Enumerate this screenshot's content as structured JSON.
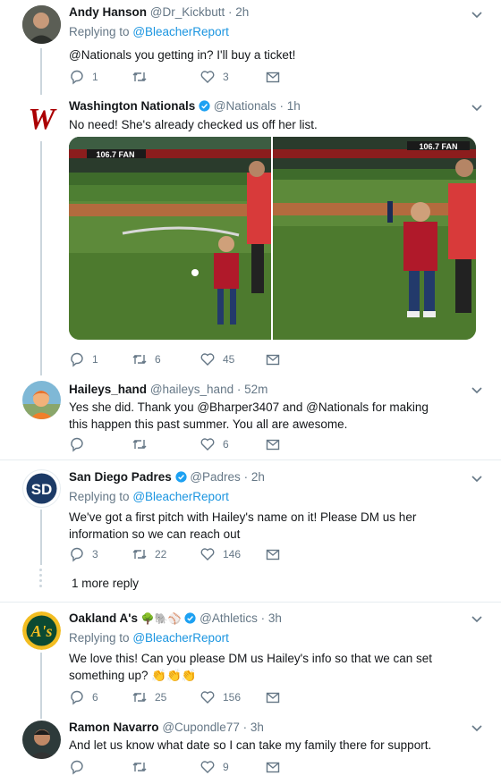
{
  "tweets": [
    {
      "name": "Andy Hanson",
      "handle": "@Dr_Kickbutt",
      "time": "· 2h",
      "replying_label": "Replying to",
      "replying_to": "@BleacherReport",
      "text": "@Nationals you getting in? I'll buy a ticket!",
      "replies": "1",
      "retweets": "",
      "likes": "3"
    },
    {
      "name": "Washington Nationals",
      "handle": "@Nationals",
      "time": "· 1h",
      "text": "No need! She's already checked us off her list.",
      "photo_left_banner": "106.7 FAN",
      "photo_right_banner": "106.7 FAN",
      "replies": "1",
      "retweets": "6",
      "likes": "45"
    },
    {
      "name": "Haileys_hand",
      "handle": "@haileys_hand",
      "time": "· 52m",
      "text": "Yes she did. Thank you @Bharper3407 and @Nationals for making this happen this past summer. You all are awesome.",
      "replies": "",
      "retweets": "",
      "likes": "6"
    },
    {
      "name": "San Diego Padres",
      "handle": "@Padres",
      "time": "· 2h",
      "replying_label": "Replying to",
      "replying_to": "@BleacherReport",
      "text": "We've got a first pitch with Hailey's name on it! Please DM us her information so we can reach out",
      "replies": "3",
      "retweets": "22",
      "likes": "146"
    },
    {
      "name": "Oakland A's",
      "handle": "@Athletics",
      "time": "· 3h",
      "name_emojis": "🌳🐘⚾",
      "replying_label": "Replying to",
      "replying_to": "@BleacherReport",
      "text": "We love this! Can you please DM us Hailey's info so that we can set something up? 👏👏👏",
      "replies": "6",
      "retweets": "25",
      "likes": "156"
    },
    {
      "name": "Ramon Navarro",
      "handle": "@Cupondle77",
      "time": "· 3h",
      "text": "And let us know what date so I can take my family there for support.",
      "replies": "",
      "retweets": "",
      "likes": "9"
    }
  ],
  "more_replies": "1 more reply",
  "colors": {
    "blue": "#1da1f2",
    "gray": "#657786",
    "line": "#ccd6dd"
  }
}
